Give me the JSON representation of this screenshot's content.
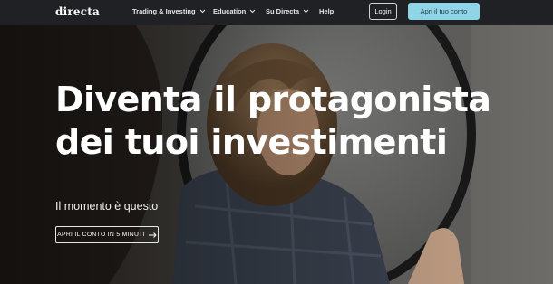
{
  "brand": {
    "name": "directa"
  },
  "nav": {
    "items": [
      {
        "label": "Trading & Investing",
        "has_dropdown": true
      },
      {
        "label": "Education",
        "has_dropdown": true
      },
      {
        "label": "Su Directa",
        "has_dropdown": true
      },
      {
        "label": "Help",
        "has_dropdown": false
      }
    ],
    "login_label": "Login",
    "open_account_label": "Apri il tuo conto"
  },
  "hero": {
    "title_line1": "Diventa il protagonista",
    "title_line2": "dei tuoi investimenti",
    "subtitle": "Il momento è questo",
    "cta_label": "APRI IL CONTO IN 5 MINUTI",
    "cta_icon": "arrow-right-icon"
  },
  "colors": {
    "navbar_bg": "#1f2125",
    "accent": "#8fd5e7",
    "text": "#ffffff"
  }
}
